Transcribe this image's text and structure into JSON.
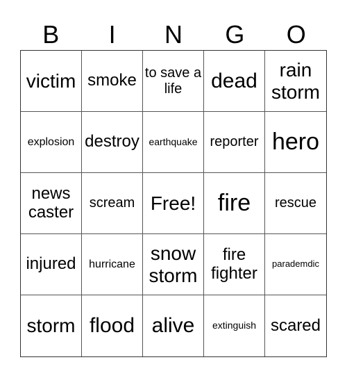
{
  "header": {
    "letters": [
      "B",
      "I",
      "N",
      "G",
      "O"
    ]
  },
  "card": {
    "cells": [
      [
        "victim",
        "smoke",
        "to save a life",
        "dead",
        "rain storm"
      ],
      [
        "explosion",
        "destroy",
        "earthquake",
        "reporter",
        "hero"
      ],
      [
        "news caster",
        "scream",
        "Free!",
        "fire",
        "rescue"
      ],
      [
        "injured",
        "hurricane",
        "snow storm",
        "fire fighter",
        "parademdic"
      ],
      [
        "storm",
        "flood",
        "alive",
        "extinguish",
        "scared"
      ]
    ]
  }
}
